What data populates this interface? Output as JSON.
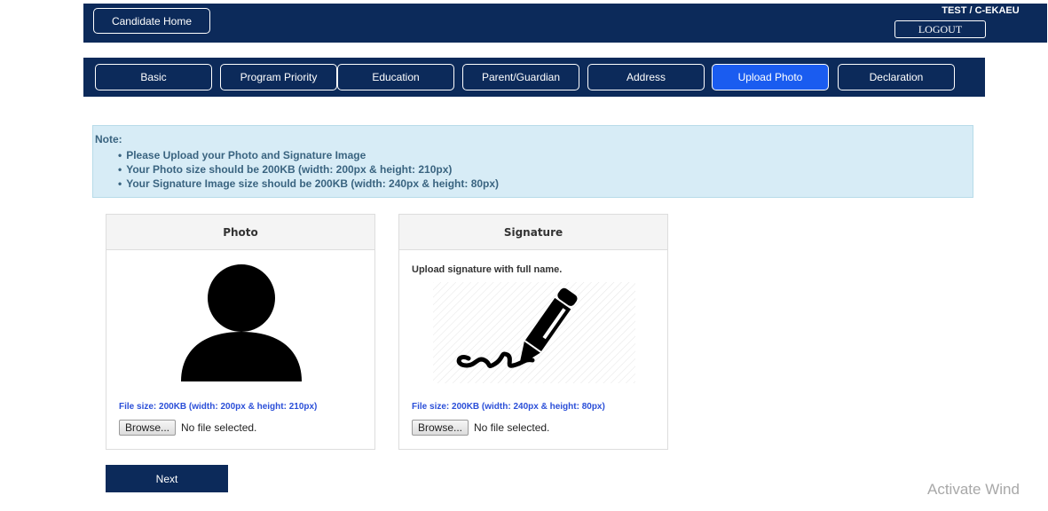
{
  "header": {
    "home_label": "Candidate Home",
    "user_label": "TEST / C-EKAEU",
    "logout_label": "LOGOUT"
  },
  "tabs": [
    {
      "label": "Basic"
    },
    {
      "label": "Program Priority"
    },
    {
      "label": "Education"
    },
    {
      "label": "Parent/Guardian"
    },
    {
      "label": "Address"
    },
    {
      "label": "Upload Photo",
      "active": true
    },
    {
      "label": "Declaration"
    }
  ],
  "note": {
    "title": "Note:",
    "items": [
      "Please Upload your Photo and Signature Image",
      "Your Photo size should be 200KB (width: 200px & height: 210px)",
      "Your Signature Image size should be 200KB (width: 240px & height: 80px)"
    ]
  },
  "photo_panel": {
    "title": "Photo",
    "icon": "person-silhouette-icon",
    "file_size": "File size: 200KB (width: 200px & height: 210px)",
    "browse_label": "Browse...",
    "file_status": "No file selected."
  },
  "signature_panel": {
    "title": "Signature",
    "instruction": "Upload signature with full name.",
    "icon": "pen-signature-icon",
    "file_size": "File size: 200KB (width: 240px & height: 80px)",
    "browse_label": "Browse...",
    "file_status": "No file selected."
  },
  "next_label": "Next",
  "watermark": "Activate Wind",
  "colors": {
    "navy": "#0c2a5a",
    "active_tab": "#1a5cf0",
    "note_bg": "#d7ecf6",
    "file_size_text": "#2b4fd8"
  }
}
